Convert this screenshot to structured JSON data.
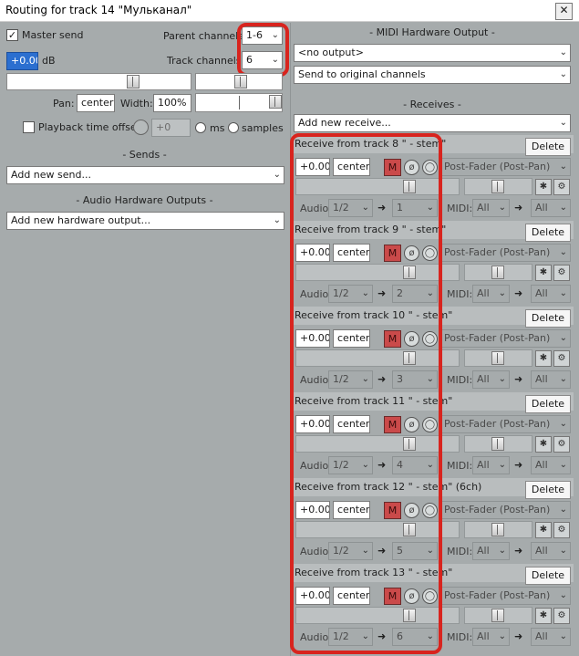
{
  "window": {
    "title": "Routing for track 14 \"Мульканал\"",
    "close_glyph": "✕"
  },
  "master_send": {
    "label": "Master send",
    "checked": true
  },
  "parent_channels": {
    "label": "Parent channels:",
    "value": "1-6"
  },
  "track_channels": {
    "label": "Track channels:",
    "value": "6"
  },
  "volume": {
    "value": "+0.00",
    "unit": "dB"
  },
  "pan": {
    "label": "Pan:",
    "value": "center"
  },
  "width": {
    "label": "Width:",
    "value": "100%"
  },
  "playback_offset": {
    "label": "Playback time offset:",
    "value": "+0",
    "unit_ms": "ms",
    "unit_samples": "samples"
  },
  "sends": {
    "heading": "- Sends -",
    "add_label": "Add new send..."
  },
  "audio_hw": {
    "heading": "- Audio Hardware Outputs -",
    "add_label": "Add new hardware output..."
  },
  "midi_hw": {
    "heading": "- MIDI Hardware Output -",
    "output": "<no output>",
    "mode": "Send to original channels"
  },
  "receives_section": {
    "heading": "- Receives -",
    "add_label": "Add new receive..."
  },
  "receive_common": {
    "volume": "+0.00",
    "pan": "center",
    "delete_label": "Delete",
    "mute_label": "M",
    "mode": "Post-Fader (Post-Pan)",
    "audio_label": "Audio:",
    "audio_src": "1/2",
    "arrow": "➜",
    "midi_label": "MIDI:",
    "midi_src": "All",
    "midi_dst": "All"
  },
  "receives": [
    {
      "title": "Receive from track 8 \" - stem\"",
      "audio_dst": "1"
    },
    {
      "title": "Receive from track 9 \" - stem\"",
      "audio_dst": "2"
    },
    {
      "title": "Receive from track 10 \" - stem\"",
      "audio_dst": "3"
    },
    {
      "title": "Receive from track 11 \" - stem\"",
      "audio_dst": "4"
    },
    {
      "title": "Receive from track 12 \" - stem\" (6ch)",
      "audio_dst": "5"
    },
    {
      "title": "Receive from track 13 \" - stem\"",
      "audio_dst": "6"
    }
  ],
  "colors": {
    "highlight": "#d8241e",
    "background": "#a6abac",
    "mute": "#ca4a4a"
  },
  "icons": {
    "close": "close-icon",
    "dropdown": "chevron-down-icon",
    "phase": "phase-invert-icon",
    "mono": "mono-stereo-icon",
    "envelope": "envelope-icon",
    "io": "io-icon"
  }
}
